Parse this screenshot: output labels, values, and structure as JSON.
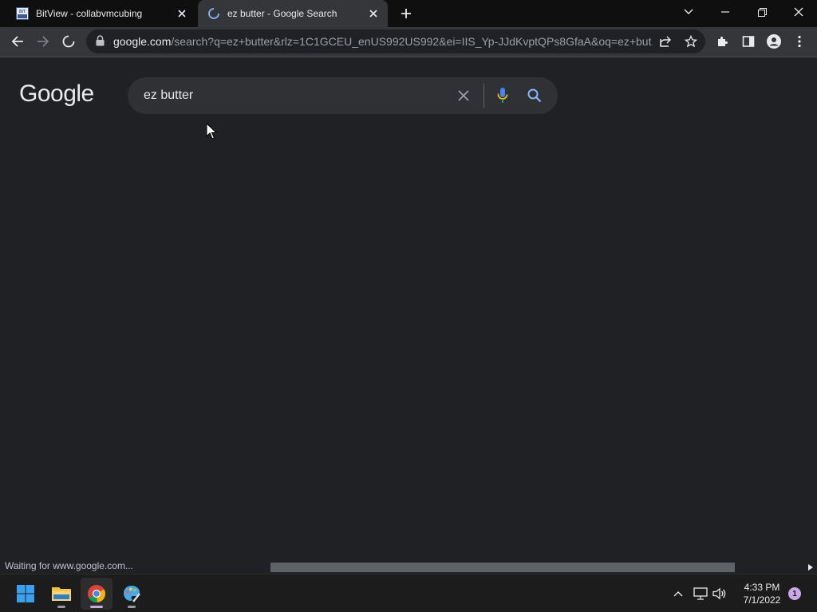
{
  "tabs": [
    {
      "title": "BitView - collabvmcubing",
      "favicon": "bitview-icon",
      "favicon_text": "BIT VIEW"
    },
    {
      "title": "ez butter - Google Search",
      "favicon": "loading-spinner-icon"
    }
  ],
  "address_bar": {
    "host": "google.com",
    "path": "/search?q=ez+butter&rlz=1C1GCEU_enUS992US992&ei=IIS_Yp-JJdKvptQPs8GfaA&oq=ez+but..."
  },
  "page": {
    "logo": "Google",
    "search_value": "ez butter"
  },
  "status_text": "Waiting for www.google.com...",
  "taskbar": {
    "time": "4:33 PM",
    "date": "7/1/2022",
    "notification_count": "1"
  },
  "colors": {
    "background": "#202124",
    "toolbar": "#35363a",
    "mic_blue": "#4285f4",
    "search_blue": "#8ab4f8"
  }
}
